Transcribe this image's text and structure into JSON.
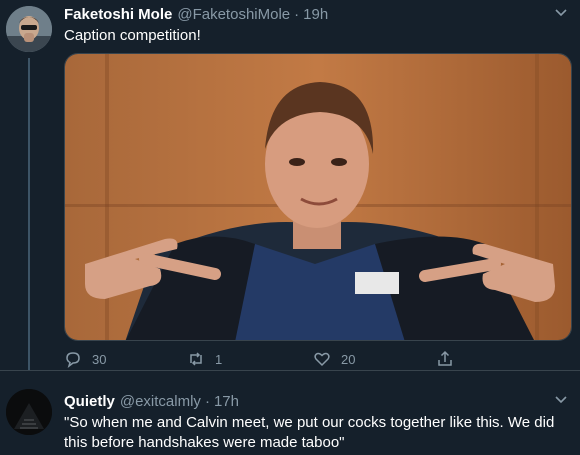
{
  "tweets": [
    {
      "author_name": "Faketoshi Mole",
      "handle": "@FaketoshiMole",
      "separator": "·",
      "time": "19h",
      "text": "Caption competition!",
      "replies": "30",
      "retweets": "1",
      "likes": "20"
    },
    {
      "author_name": "Quietly",
      "handle": "@exitcalmly",
      "separator": "·",
      "time": "17h",
      "text": "\"So when me and Calvin meet, we put our cocks together like this. We did this before handshakes were made taboo\""
    }
  ],
  "icons": {
    "reply": "reply-icon",
    "retweet": "retweet-icon",
    "like": "heart-icon",
    "share": "share-icon",
    "more": "chevron-down-icon"
  },
  "colors": {
    "background": "#15202b",
    "secondary_text": "#8899a6",
    "divider": "#38444d"
  }
}
